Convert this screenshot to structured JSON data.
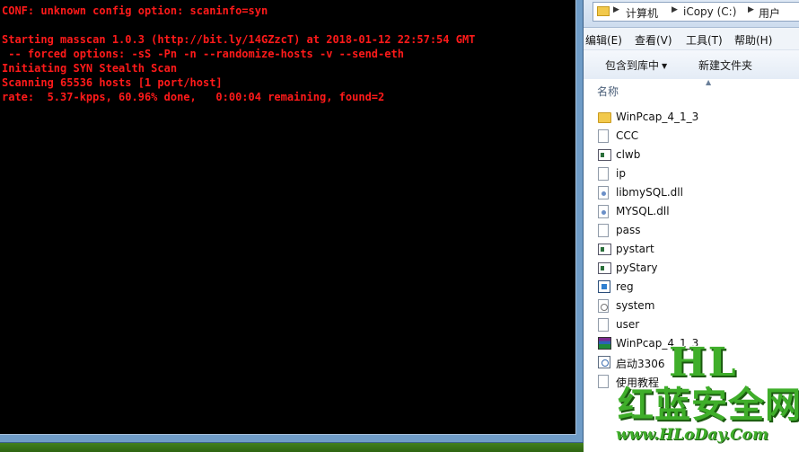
{
  "console": {
    "lines": [
      "CONF: unknown config option: scaninfo=syn",
      "",
      "Starting masscan 1.0.3 (http://bit.ly/14GZzcT) at 2018-01-12 22:57:54 GMT",
      " -- forced options: -sS -Pn -n --randomize-hosts -v --send-eth",
      "Initiating SYN Stealth Scan",
      "Scanning 65536 hosts [1 port/host]",
      "rate:  5.37-kpps, 60.96% done,   0:00:04 remaining, found=2"
    ],
    "text_color": "#ff1a1a",
    "background": "#000000"
  },
  "explorer": {
    "breadcrumb": [
      "计算机",
      "iCopy (C:)",
      "用户"
    ],
    "menu": [
      "编辑(E)",
      "查看(V)",
      "工具(T)",
      "帮助(H)"
    ],
    "toolbar": {
      "include_library": "包含到库中",
      "new_folder": "新建文件夹"
    },
    "column_name": "名称",
    "files": [
      {
        "name": "WinPcap_4_1_3",
        "icon": "folder-icon"
      },
      {
        "name": "CCC",
        "icon": "text-file-icon"
      },
      {
        "name": "clwb",
        "icon": "exe-icon"
      },
      {
        "name": "ip",
        "icon": "text-file-icon"
      },
      {
        "name": "libmySQL.dll",
        "icon": "dll-icon"
      },
      {
        "name": "MYSQL.dll",
        "icon": "dll-icon"
      },
      {
        "name": "pass",
        "icon": "text-file-icon"
      },
      {
        "name": "pystart",
        "icon": "exe-icon"
      },
      {
        "name": "pyStary",
        "icon": "exe-icon"
      },
      {
        "name": "reg",
        "icon": "registry-icon"
      },
      {
        "name": "system",
        "icon": "system-file-icon"
      },
      {
        "name": "user",
        "icon": "text-file-icon"
      },
      {
        "name": "WinPcap_4_1_3",
        "icon": "rar-archive-icon"
      },
      {
        "name": "启动3306",
        "icon": "batch-file-icon"
      },
      {
        "name": "使用教程",
        "icon": "text-file-icon"
      }
    ]
  },
  "watermark": {
    "logo": "HL",
    "brand": "红蓝安全网",
    "url": "www.HLoDay.Com",
    "color": "#3fae2a"
  }
}
